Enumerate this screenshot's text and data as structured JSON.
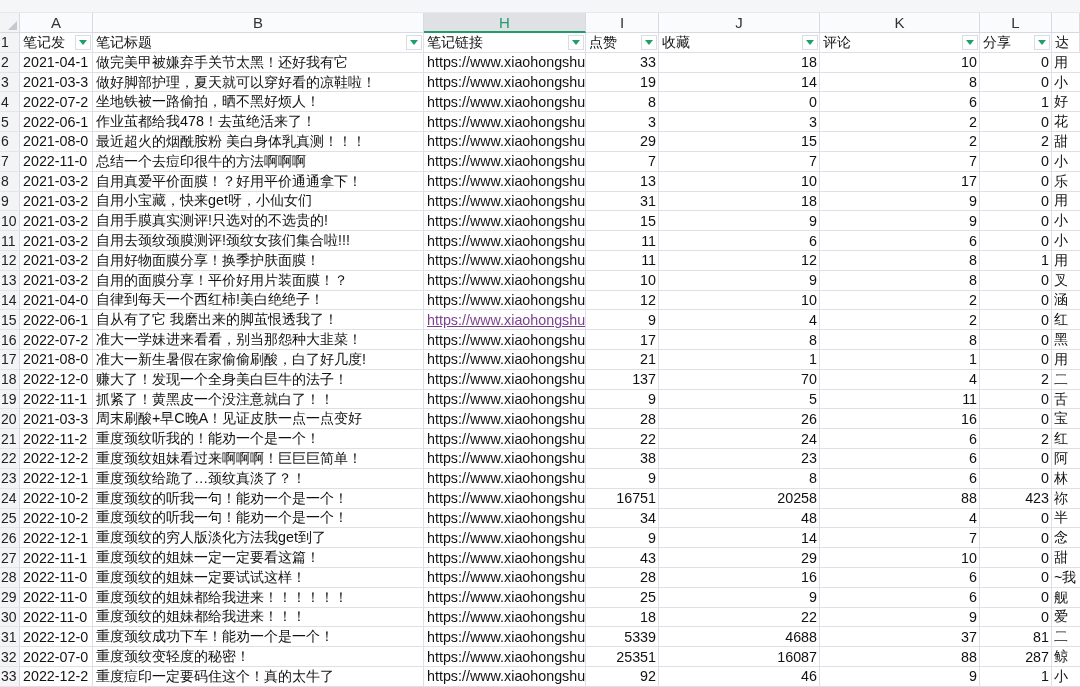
{
  "columns": [
    {
      "letter": "A",
      "selected": false
    },
    {
      "letter": "B",
      "selected": false
    },
    {
      "letter": "H",
      "selected": true
    },
    {
      "letter": "I",
      "selected": false
    },
    {
      "letter": "J",
      "selected": false
    },
    {
      "letter": "K",
      "selected": false
    },
    {
      "letter": "L",
      "selected": false
    },
    {
      "selected": false
    }
  ],
  "header_row": {
    "n": "1",
    "cells": [
      {
        "text": "笔记发",
        "filter": true
      },
      {
        "text": "笔记标题",
        "filter": true
      },
      {
        "text": "笔记链接",
        "filter": true
      },
      {
        "text": "点赞",
        "filter": true
      },
      {
        "text": "收藏",
        "filter": true
      },
      {
        "text": "评论",
        "filter": true
      },
      {
        "text": "分享",
        "filter": true
      },
      {
        "text": "达",
        "filter": false
      }
    ]
  },
  "rows": [
    {
      "n": "2",
      "date": "2021-04-1",
      "title": "做完美甲被嫌弃手关节太黑！还好我有它",
      "link": "https://www.xiaohongshu",
      "visited": false,
      "likes": "33",
      "saves": "18",
      "comments": "10",
      "shares": "0",
      "column_m": "用"
    },
    {
      "n": "3",
      "date": "2021-03-3",
      "title": "做好脚部护理，夏天就可以穿好看的凉鞋啦！",
      "link": "https://www.xiaohongshu",
      "visited": false,
      "likes": "19",
      "saves": "14",
      "comments": "8",
      "shares": "0",
      "column_m": "小"
    },
    {
      "n": "4",
      "date": "2022-07-2",
      "title": "坐地铁被一路偷拍，晒不黑好烦人！",
      "link": "https://www.xiaohongshu",
      "visited": false,
      "likes": "8",
      "saves": "0",
      "comments": "6",
      "shares": "1",
      "column_m": "好"
    },
    {
      "n": "5",
      "date": "2022-06-1",
      "title": "作业茧都给我478！去茧绝活来了！",
      "link": "https://www.xiaohongshu",
      "visited": false,
      "likes": "3",
      "saves": "3",
      "comments": "2",
      "shares": "0",
      "column_m": "花"
    },
    {
      "n": "6",
      "date": "2021-08-0",
      "title": "最近超火的烟酰胺粉 美白身体乳真测！！！",
      "link": "https://www.xiaohongshu",
      "visited": false,
      "likes": "29",
      "saves": "15",
      "comments": "2",
      "shares": "2",
      "column_m": "甜"
    },
    {
      "n": "7",
      "date": "2022-11-0",
      "title": "总结一个去痘印很牛的方法啊啊啊",
      "link": "https://www.xiaohongshu",
      "visited": false,
      "likes": "7",
      "saves": "7",
      "comments": "7",
      "shares": "0",
      "column_m": "小"
    },
    {
      "n": "8",
      "date": "2021-03-2",
      "title": "自用真爱平价面膜！？好用平价通通拿下！",
      "link": "https://www.xiaohongshu",
      "visited": false,
      "likes": "13",
      "saves": "10",
      "comments": "17",
      "shares": "0",
      "column_m": "乐"
    },
    {
      "n": "9",
      "date": "2021-03-2",
      "title": "自用小宝藏，快来get呀，小仙女们",
      "link": "https://www.xiaohongshu",
      "visited": false,
      "likes": "31",
      "saves": "18",
      "comments": "9",
      "shares": "0",
      "column_m": "用"
    },
    {
      "n": "10",
      "date": "2021-03-2",
      "title": "自用手膜真实测评!只选对的不选贵的!",
      "link": "https://www.xiaohongshu",
      "visited": false,
      "likes": "15",
      "saves": "9",
      "comments": "9",
      "shares": "0",
      "column_m": "小"
    },
    {
      "n": "11",
      "date": "2021-03-2",
      "title": "自用去颈纹颈膜测评!颈纹女孩们集合啦!!!",
      "link": "https://www.xiaohongshu",
      "visited": false,
      "likes": "11",
      "saves": "6",
      "comments": "6",
      "shares": "0",
      "column_m": "小"
    },
    {
      "n": "12",
      "date": "2021-03-2",
      "title": "自用好物面膜分享！换季护肤面膜！",
      "link": "https://www.xiaohongshu",
      "visited": false,
      "likes": "11",
      "saves": "12",
      "comments": "8",
      "shares": "1",
      "column_m": "用"
    },
    {
      "n": "13",
      "date": "2021-03-2",
      "title": "自用的面膜分享！平价好用片装面膜！？",
      "link": "https://www.xiaohongshu",
      "visited": false,
      "likes": "10",
      "saves": "9",
      "comments": "8",
      "shares": "0",
      "column_m": "叉"
    },
    {
      "n": "14",
      "date": "2021-04-0",
      "title": "自律到每天一个西红柿!美白绝绝子！",
      "link": "https://www.xiaohongshu",
      "visited": false,
      "likes": "12",
      "saves": "10",
      "comments": "2",
      "shares": "0",
      "column_m": "涵"
    },
    {
      "n": "15",
      "date": "2022-06-1",
      "title": "自从有了它 我磨出来的脚茧恨透我了！",
      "link": "https://www.xiaohongshu",
      "visited": true,
      "likes": "9",
      "saves": "4",
      "comments": "2",
      "shares": "0",
      "column_m": "红"
    },
    {
      "n": "16",
      "date": "2022-07-2",
      "title": "准大一学妹进来看看，别当那怨种大韭菜！",
      "link": "https://www.xiaohongshu",
      "visited": false,
      "likes": "17",
      "saves": "8",
      "comments": "8",
      "shares": "0",
      "column_m": "黑"
    },
    {
      "n": "17",
      "date": "2021-08-0",
      "title": "准大一新生暑假在家偷偷刷酸，白了好几度!",
      "link": "https://www.xiaohongshu",
      "visited": false,
      "likes": "21",
      "saves": "1",
      "comments": "1",
      "shares": "0",
      "column_m": "用"
    },
    {
      "n": "18",
      "date": "2022-12-0",
      "title": "赚大了！发现一个全身美白巨牛的法子！",
      "link": "https://www.xiaohongshu",
      "visited": false,
      "likes": "137",
      "saves": "70",
      "comments": "4",
      "shares": "2",
      "column_m": "二"
    },
    {
      "n": "19",
      "date": "2022-11-1",
      "title": "抓紧了！黄黑皮一个没注意就白了！！",
      "link": "https://www.xiaohongshu",
      "visited": false,
      "likes": "9",
      "saves": "5",
      "comments": "11",
      "shares": "0",
      "column_m": "舌"
    },
    {
      "n": "20",
      "date": "2021-03-3",
      "title": "周末刷酸+早C晚A！见证皮肤一点一点变好",
      "link": "https://www.xiaohongshu",
      "visited": false,
      "likes": "28",
      "saves": "26",
      "comments": "16",
      "shares": "0",
      "column_m": "宝"
    },
    {
      "n": "21",
      "date": "2022-11-2",
      "title": "重度颈纹听我的！能劝一个是一个！",
      "link": "https://www.xiaohongshu",
      "visited": false,
      "likes": "22",
      "saves": "24",
      "comments": "6",
      "shares": "2",
      "column_m": "红"
    },
    {
      "n": "22",
      "date": "2022-12-2",
      "title": "重度颈纹姐妹看过来啊啊啊！巨巨巨简单！",
      "link": "https://www.xiaohongshu",
      "visited": false,
      "likes": "38",
      "saves": "23",
      "comments": "6",
      "shares": "0",
      "column_m": "阿"
    },
    {
      "n": "23",
      "date": "2022-12-1",
      "title": "重度颈纹给跪了…颈纹真淡了？！",
      "link": "https://www.xiaohongshu",
      "visited": false,
      "likes": "9",
      "saves": "8",
      "comments": "6",
      "shares": "0",
      "column_m": "林"
    },
    {
      "n": "24",
      "date": "2022-10-2",
      "title": "重度颈纹的听我一句！能劝一个是一个！",
      "link": "https://www.xiaohongshu",
      "visited": false,
      "likes": "16751",
      "saves": "20258",
      "comments": "88",
      "shares": "423",
      "column_m": "祢"
    },
    {
      "n": "25",
      "date": "2022-10-2",
      "title": "重度颈纹的听我一句！能劝一个是一个！",
      "link": "https://www.xiaohongshu",
      "visited": false,
      "likes": "34",
      "saves": "48",
      "comments": "4",
      "shares": "0",
      "column_m": "半"
    },
    {
      "n": "26",
      "date": "2022-12-1",
      "title": "重度颈纹的穷人版淡化方法我get到了",
      "link": "https://www.xiaohongshu",
      "visited": false,
      "likes": "9",
      "saves": "14",
      "comments": "7",
      "shares": "0",
      "column_m": "念"
    },
    {
      "n": "27",
      "date": "2022-11-1",
      "title": "重度颈纹的姐妹一定一定要看这篇！",
      "link": "https://www.xiaohongshu",
      "visited": false,
      "likes": "43",
      "saves": "29",
      "comments": "10",
      "shares": "0",
      "column_m": "甜"
    },
    {
      "n": "28",
      "date": "2022-11-0",
      "title": "重度颈纹的姐妹一定要试试这样！",
      "link": "https://www.xiaohongshu",
      "visited": false,
      "likes": "28",
      "saves": "16",
      "comments": "6",
      "shares": "0",
      "column_m": "~我"
    },
    {
      "n": "29",
      "date": "2022-11-0",
      "title": "重度颈纹的姐妹都给我进来！！！！！！",
      "link": "https://www.xiaohongshu",
      "visited": false,
      "likes": "25",
      "saves": "9",
      "comments": "6",
      "shares": "0",
      "column_m": "舰"
    },
    {
      "n": "30",
      "date": "2022-11-0",
      "title": "重度颈纹的姐妹都给我进来！！！",
      "link": "https://www.xiaohongshu",
      "visited": false,
      "likes": "18",
      "saves": "22",
      "comments": "9",
      "shares": "0",
      "column_m": "爱"
    },
    {
      "n": "31",
      "date": "2022-12-0",
      "title": "重度颈纹成功下车！能劝一个是一个！",
      "link": "https://www.xiaohongshu",
      "visited": false,
      "likes": "5339",
      "saves": "4688",
      "comments": "37",
      "shares": "81",
      "column_m": "二"
    },
    {
      "n": "32",
      "date": "2022-07-0",
      "title": "重度颈纹变轻度的秘密！",
      "link": "https://www.xiaohongshu",
      "visited": false,
      "likes": "25351",
      "saves": "16087",
      "comments": "88",
      "shares": "287",
      "column_m": "鲸"
    },
    {
      "n": "33",
      "date": "2022-12-2",
      "title": "重度痘印一定要码住这个！真的太牛了",
      "link": "https://www.xiaohongshu",
      "visited": false,
      "likes": "92",
      "saves": "46",
      "comments": "9",
      "shares": "1",
      "column_m": "小"
    }
  ]
}
